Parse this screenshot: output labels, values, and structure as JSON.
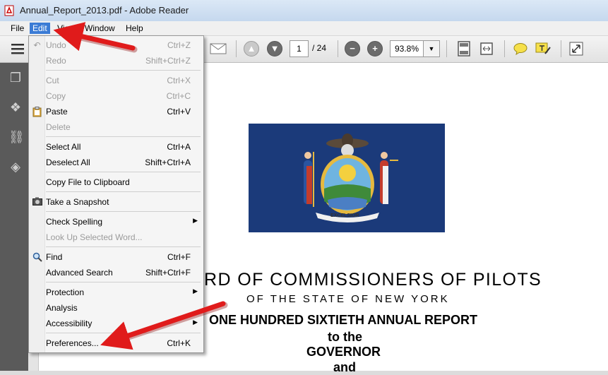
{
  "window": {
    "title": "Annual_Report_2013.pdf - Adobe Reader"
  },
  "menubar": [
    "File",
    "Edit",
    "View",
    "Window",
    "Help"
  ],
  "toolbar": {
    "page_current": "1",
    "page_total": "/ 24",
    "zoom": "93.8%"
  },
  "edit_menu": [
    {
      "label": "Undo",
      "shortcut": "Ctrl+Z",
      "disabled": true
    },
    {
      "label": "Redo",
      "shortcut": "Shift+Ctrl+Z",
      "disabled": true
    },
    {
      "label": "Cut",
      "shortcut": "Ctrl+X",
      "disabled": true
    },
    {
      "label": "Copy",
      "shortcut": "Ctrl+C",
      "disabled": true
    },
    {
      "label": "Paste",
      "shortcut": "Ctrl+V",
      "disabled": false
    },
    {
      "label": "Delete",
      "shortcut": "",
      "disabled": true
    },
    {
      "label": "Select All",
      "shortcut": "Ctrl+A",
      "disabled": false
    },
    {
      "label": "Deselect All",
      "shortcut": "Shift+Ctrl+A",
      "disabled": false
    },
    {
      "label": "Copy File to Clipboard",
      "shortcut": "",
      "disabled": false
    },
    {
      "label": "Take a Snapshot",
      "shortcut": "",
      "disabled": false
    },
    {
      "label": "Check Spelling",
      "shortcut": "",
      "disabled": false
    },
    {
      "label": "Look Up Selected Word...",
      "shortcut": "",
      "disabled": true
    },
    {
      "label": "Find",
      "shortcut": "Ctrl+F",
      "disabled": false
    },
    {
      "label": "Advanced Search",
      "shortcut": "Shift+Ctrl+F",
      "disabled": false
    },
    {
      "label": "Protection",
      "shortcut": "",
      "disabled": false
    },
    {
      "label": "Analysis",
      "shortcut": "",
      "disabled": false
    },
    {
      "label": "Accessibility",
      "shortcut": "",
      "disabled": false
    },
    {
      "label": "Preferences...",
      "shortcut": "Ctrl+K",
      "disabled": false
    }
  ],
  "document": {
    "line1": "RD OF COMMISSIONERS OF PILOTS",
    "line2": "OF THE STATE OF NEW YORK",
    "line3": "ONE HUNDRED SIXTIETH ANNUAL REPORT",
    "line4": "to the",
    "line5": "GOVERNOR",
    "line6": "and",
    "flag_motto": "EXCELSIOR"
  },
  "colors": {
    "accent": "#3a7bd5",
    "flag_blue": "#1b3a7a",
    "arrow_red": "#e01b1b"
  }
}
